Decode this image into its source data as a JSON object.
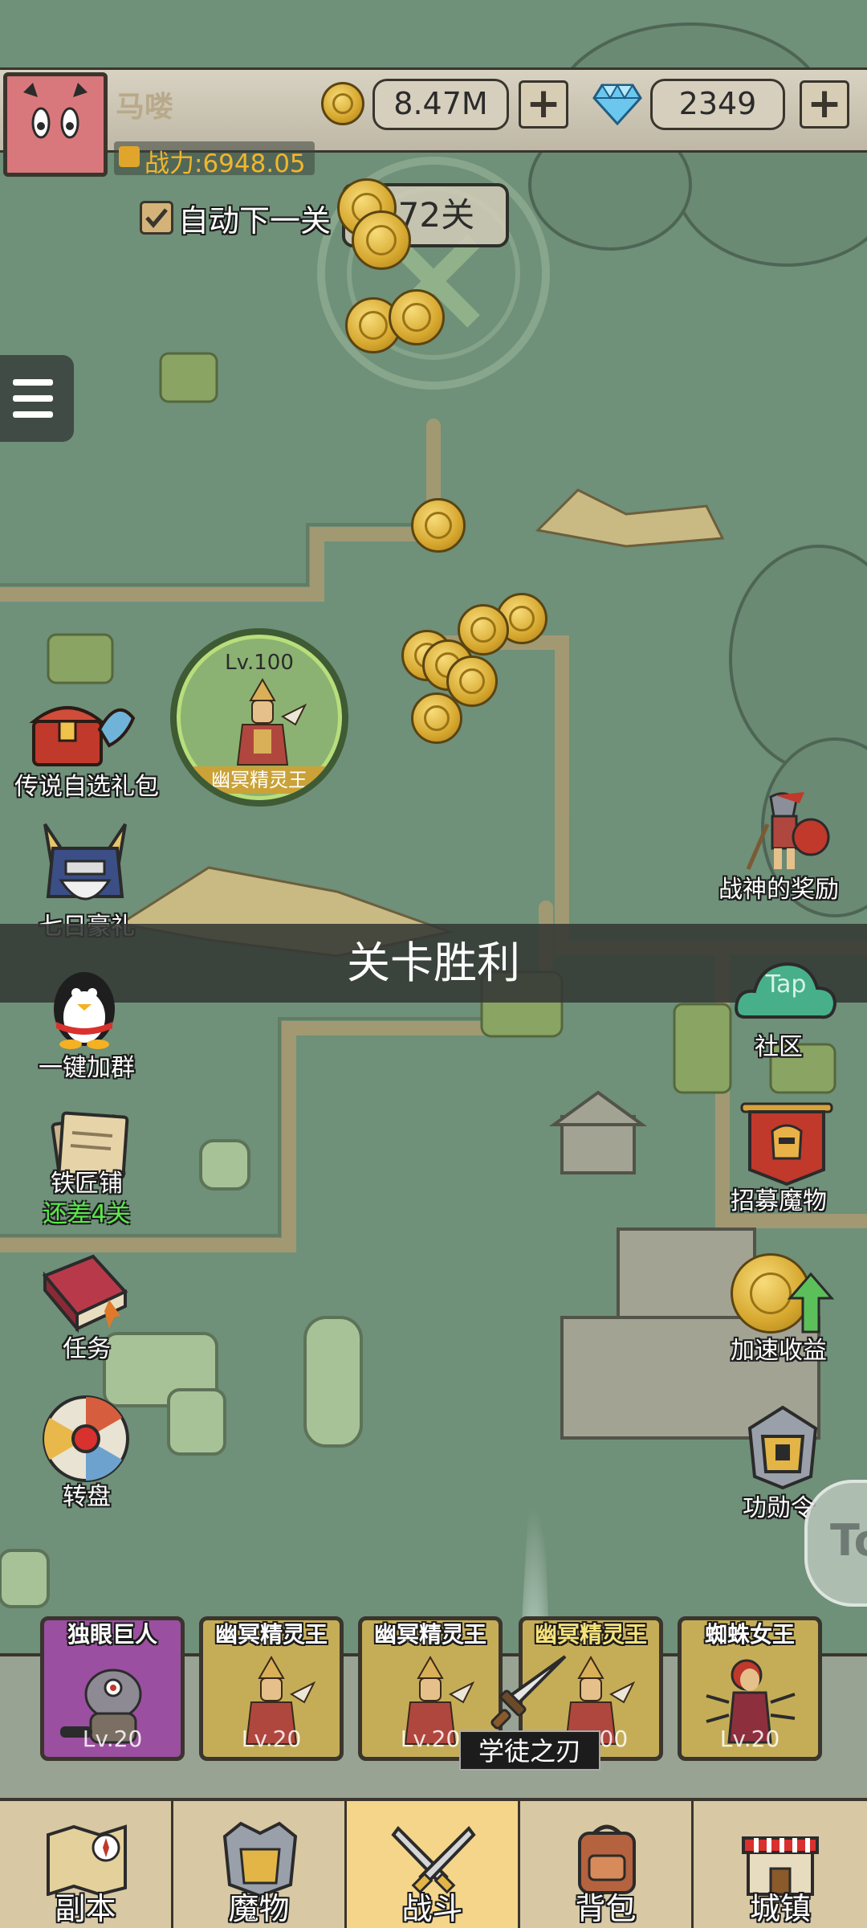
{
  "player": {
    "name": "马喽",
    "power_label": "战力:6948.05",
    "gold": "8.47M",
    "gems": "2349"
  },
  "stage": {
    "auto_next_label": "自动下一关",
    "auto_next_checked": true,
    "level_label": "672关"
  },
  "boss": {
    "level": "Lv.100",
    "name": "幽冥精灵王"
  },
  "banner": "关卡胜利",
  "left_menu": [
    {
      "label": "传说自选礼包",
      "icon": "treasure-chest-icon"
    },
    {
      "label": "七日豪礼",
      "icon": "knight-helmet-icon"
    },
    {
      "label": "一键加群",
      "icon": "penguin-icon"
    },
    {
      "label": "铁匠铺",
      "sub": "还差4关",
      "icon": "scroll-book-icon"
    },
    {
      "label": "任务",
      "icon": "quest-book-icon"
    },
    {
      "label": "转盘",
      "icon": "wheel-icon"
    }
  ],
  "right_menu": [
    {
      "label": "战神的奖励",
      "icon": "spartan-warrior-icon"
    },
    {
      "label": "社区",
      "badge": "Tap",
      "icon": "community-cloud-icon"
    },
    {
      "label": "招募魔物",
      "icon": "recruit-banner-icon"
    },
    {
      "label": "加速收益",
      "icon": "coin-boost-icon"
    },
    {
      "label": "功勋令",
      "icon": "medal-helmet-icon"
    }
  ],
  "floating_tap": "To",
  "team": [
    {
      "name": "独眼巨人",
      "level": "Lv.20",
      "color": "#9b4fa0"
    },
    {
      "name": "幽冥精灵王",
      "level": "Lv.20",
      "color": "#c8aa52"
    },
    {
      "name": "幽冥精灵王",
      "level": "Lv.20",
      "color": "#c8aa52"
    },
    {
      "name": "幽冥精灵王",
      "level": "Lv.100",
      "color": "#c8aa52"
    },
    {
      "name": "蜘蛛女王",
      "level": "Lv.20",
      "color": "#c8aa52"
    }
  ],
  "drop_item": "学徒之刃",
  "nav": [
    {
      "label": "副本",
      "icon": "map-icon"
    },
    {
      "label": "魔物",
      "icon": "monster-helmet-icon"
    },
    {
      "label": "战斗",
      "icon": "crossed-swords-icon",
      "active": true
    },
    {
      "label": "背包",
      "icon": "backpack-icon"
    },
    {
      "label": "城镇",
      "icon": "town-shop-icon"
    }
  ],
  "colors": {
    "accent_gold": "#f4c542",
    "active_tab": "#f5d58a",
    "banner_bg": "#3a3d38"
  }
}
